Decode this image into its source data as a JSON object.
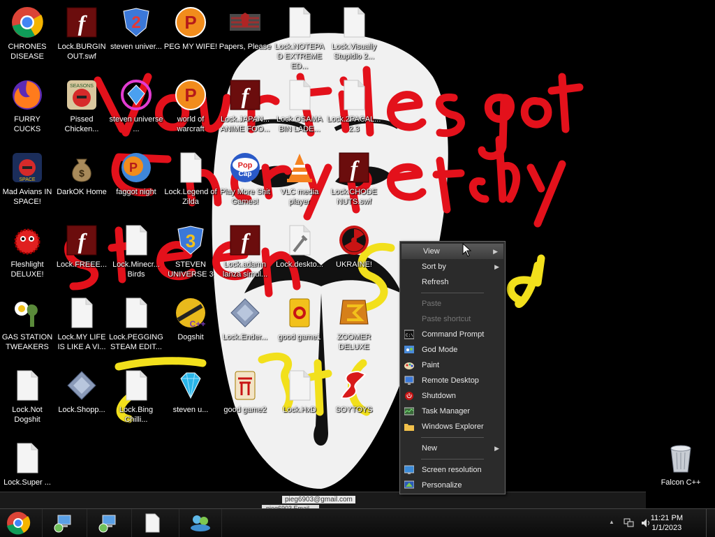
{
  "wallpaper": {
    "graffiti_lines": [
      "Your files got",
      "encrypted by",
      "steven",
      "S",
      "d"
    ]
  },
  "desktop_icons": [
    {
      "label": "CHRONES DISEASE",
      "icon": "chrome-icon"
    },
    {
      "label": "Lock.BURGIN OUT.swf",
      "icon": "flash-icon"
    },
    {
      "label": "steven univer...",
      "icon": "steven-universe-2-icon"
    },
    {
      "label": "PEG MY WIFE!",
      "icon": "peggle-icon"
    },
    {
      "label": "Papers, Please",
      "icon": "papers-please-icon"
    },
    {
      "label": "Lock.NOTEPAD EXTREME ED...",
      "icon": "file-icon"
    },
    {
      "label": "Lock.Visually Stupidio 2...",
      "icon": "file-icon"
    },
    {
      "label": "FURRY CUCKS",
      "icon": "firefox-icon"
    },
    {
      "label": "Pissed Chicken...",
      "icon": "angry-birds-seasons-icon"
    },
    {
      "label": "steven universe ...",
      "icon": "gem-icon"
    },
    {
      "label": "world of warcraft",
      "icon": "peggle-icon"
    },
    {
      "label": "Lock.JAPAN... ANIME FOO...",
      "icon": "flash-icon"
    },
    {
      "label": "Lock.OSAMA BIN LADE...",
      "icon": "file-icon"
    },
    {
      "label": "Lock.2PACAL... 2.3",
      "icon": "file-icon"
    },
    {
      "label": "Mad Avians IN SPACE!",
      "icon": "angry-birds-space-icon"
    },
    {
      "label": "DarkOK Home",
      "icon": "money-bag-icon"
    },
    {
      "label": "faggot night",
      "icon": "peggle-nights-icon"
    },
    {
      "label": "Lock.Legend of Zilda",
      "icon": "file-icon"
    },
    {
      "label": "Play More Shit Games!",
      "icon": "popcap-icon"
    },
    {
      "label": "VLC media player",
      "icon": "vlc-icon"
    },
    {
      "label": "Lock.CHODE NUTS.swf",
      "icon": "flash-icon"
    },
    {
      "label": "Fleshlight DELUXE!",
      "icon": "red-fuzzy-icon"
    },
    {
      "label": "Lock.FREEE...",
      "icon": "flash-icon"
    },
    {
      "label": "Lock.Minecr... Birds",
      "icon": "file-icon"
    },
    {
      "label": "STEVEN UNIVERSE 3",
      "icon": "steven-universe-3-icon"
    },
    {
      "label": "Lock.adamn lanza simul...",
      "icon": "flash-icon"
    },
    {
      "label": "Lock.deskto...",
      "icon": "settings-file-icon"
    },
    {
      "label": "UKRAINE!",
      "icon": "radiation-icon"
    },
    {
      "label": "GAS STATION TWEAKERS",
      "icon": "plants-zombies-icon"
    },
    {
      "label": "Lock.MY LIFE IS LIKE A VI...",
      "icon": "file-icon"
    },
    {
      "label": "Lock.PEGGING STEAM EDIT...",
      "icon": "file-icon"
    },
    {
      "label": "Dogshit",
      "icon": "cpp-icon"
    },
    {
      "label": "Lock.Ender...",
      "icon": "diamond-file-icon"
    },
    {
      "label": "good game1",
      "icon": "mahjong-icon"
    },
    {
      "label": "ZOOMER DELUXE",
      "icon": "zuma-icon"
    },
    {
      "label": "Lock.Not Dogshit",
      "icon": "file-icon"
    },
    {
      "label": "Lock.Shopp...",
      "icon": "diamond-file-icon"
    },
    {
      "label": "Lock.Bing Chilli...",
      "icon": "file-icon"
    },
    {
      "label": "steven u...",
      "icon": "blue-gem-icon"
    },
    {
      "label": "good game2",
      "icon": "mahjong-2-icon"
    },
    {
      "label": "Lock.HxD",
      "icon": "file-icon"
    },
    {
      "label": "SOYTOYS",
      "icon": "soytoys-icon"
    },
    {
      "label": "Lock.Super ...",
      "icon": "file-icon"
    },
    {
      "label": "Falcon C++",
      "icon": "recycle-bin-icon"
    }
  ],
  "context_menu": {
    "items": [
      {
        "label": "View",
        "submenu": true,
        "highlighted": true
      },
      {
        "label": "Sort by",
        "submenu": true
      },
      {
        "label": "Refresh"
      },
      {
        "separator": true
      },
      {
        "label": "Paste",
        "disabled": true
      },
      {
        "label": "Paste shortcut",
        "disabled": true
      },
      {
        "label": "Command Prompt",
        "icon": "cmd-icon"
      },
      {
        "label": "God Mode",
        "icon": "control-panel-icon"
      },
      {
        "label": "Paint",
        "icon": "paint-icon"
      },
      {
        "label": "Remote Desktop",
        "icon": "remote-desktop-icon"
      },
      {
        "label": "Shutdown",
        "icon": "shutdown-icon"
      },
      {
        "label": "Task Manager",
        "icon": "task-manager-icon"
      },
      {
        "label": "Windows Explorer",
        "icon": "folder-icon"
      },
      {
        "separator": true
      },
      {
        "label": "New",
        "submenu": true
      },
      {
        "separator": true
      },
      {
        "label": "Screen resolution",
        "icon": "screen-resolution-icon"
      },
      {
        "label": "Personalize",
        "icon": "personalize-icon"
      }
    ]
  },
  "hidden_window_text": [
    "pieg6903@gmail.com",
    "pieg6903 Email..."
  ],
  "taskbar": {
    "clock_time": "11:21 PM",
    "clock_date": "1/1/2023",
    "tray_chevron": "▲",
    "colors": {
      "bar": "#0b0b0b",
      "menu": "#2b2b2b"
    }
  }
}
